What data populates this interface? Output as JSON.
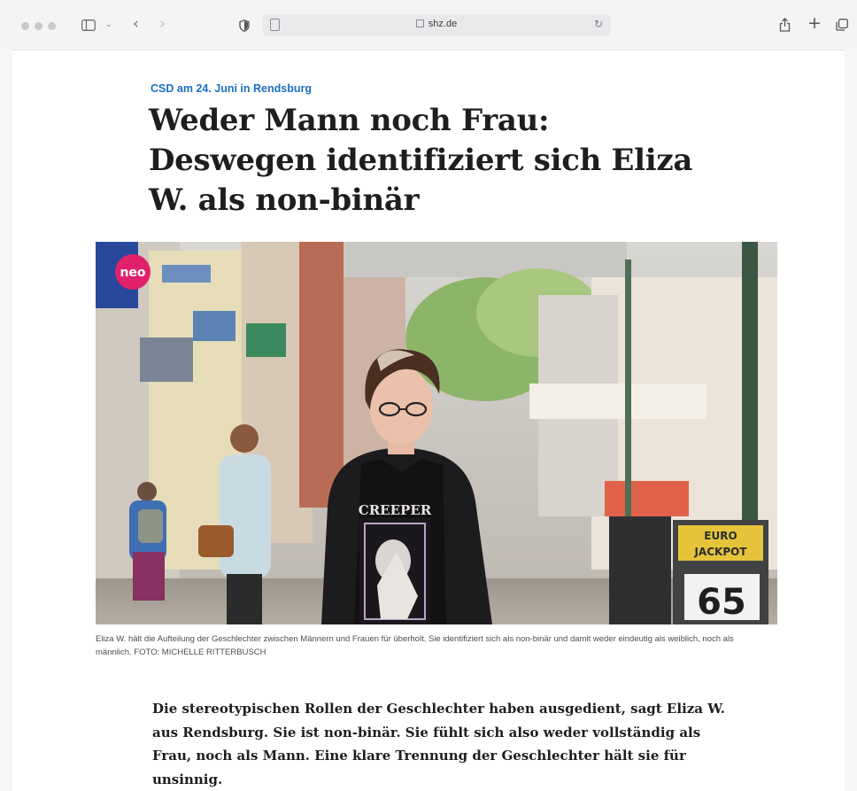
{
  "browser": {
    "url": "shz.de",
    "icons": [
      "traffic-lights",
      "sidebar-icon",
      "chevron-down-icon",
      "back-icon",
      "forward-icon",
      "privacy-shield-icon",
      "page-icon",
      "lock-icon",
      "reload-icon",
      "share-icon",
      "plus-icon",
      "tabs-icon"
    ]
  },
  "article": {
    "kicker": "CSD am 24. Juni in Rendsburg",
    "headline": "Weder Mann noch Frau: Deswegen identifiziert sich Eliza W. als non-binär",
    "photo": {
      "badge_text": "neo",
      "shirt_text": "CREEPER",
      "sign_title": "EURO JACKPOT",
      "sign_number": "65"
    },
    "caption": "Eliza W. hält die Aufteilung der Geschlechter zwischen Männern und Frauen für überholt. Sie identifiziert sich als non-binär und damit weder eindeutig als weiblich, noch als männlich.  FOTO: MICHELLE RITTERBUSCH",
    "lead": "Die stereotypischen Rollen der Geschlechter haben ausgedient, sagt Eliza W. aus Rendsburg. Sie ist non-binär. Sie fühlt sich also weder vollständig als Frau, noch als Mann. Eine klare Trennung der Geschlechter hält sie für unsinnig."
  },
  "colors": {
    "kicker": "#1d6fc2",
    "headline": "#1e1e1e",
    "badge": "#e1216b"
  }
}
